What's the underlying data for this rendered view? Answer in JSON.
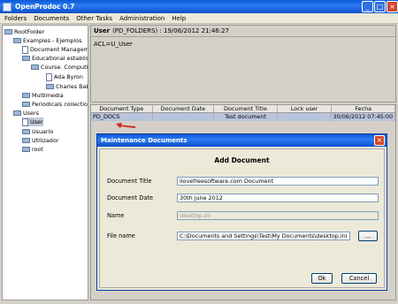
{
  "window": {
    "title": "OpenProdoc 0.7"
  },
  "menu": [
    "Folders",
    "Documents",
    "Other Tasks",
    "Administration",
    "Help"
  ],
  "tree": {
    "root": "RootFolder",
    "examples": "Examples - Ejemplos",
    "doc_management": "Document Management",
    "educational": "Educational establishment",
    "course": "Course. Computing",
    "ada": "Ada Byron",
    "charles": "Charles Babbage",
    "multimedia": "Multimedia",
    "periodicals": "Periodicals collection",
    "users": "Users",
    "user": "User",
    "usuario": "Usuario",
    "utilizador": "Utilizador",
    "root_user": "root"
  },
  "info": {
    "header_bold": "User",
    "header_rest": "(PD_FOLDERS) : 19/06/2012 21:46:27",
    "acl": "ACL=U_User"
  },
  "table": {
    "columns": [
      "Document Type",
      "Document Date",
      "Document Title",
      "Lock user",
      "Fecha"
    ],
    "rows": [
      [
        "PD_DOCS",
        "",
        "Test document",
        "",
        "30/06/2012 07:45:00"
      ]
    ]
  },
  "dialog": {
    "title": "Maintenance Documents",
    "heading": "Add Document",
    "title_label": "Document Title",
    "title_value": "ilovefreesoftware.com Document",
    "date_label": "Document Date",
    "date_value": "30th june 2012",
    "name_label": "Name",
    "name_value": "desktop.ini",
    "file_label": "File name",
    "file_value": "C:\\Documents and Settings\\Test\\My Documents\\desktop.ini",
    "browse_label": "...",
    "ok_label": "Ok",
    "cancel_label": "Cancel"
  }
}
